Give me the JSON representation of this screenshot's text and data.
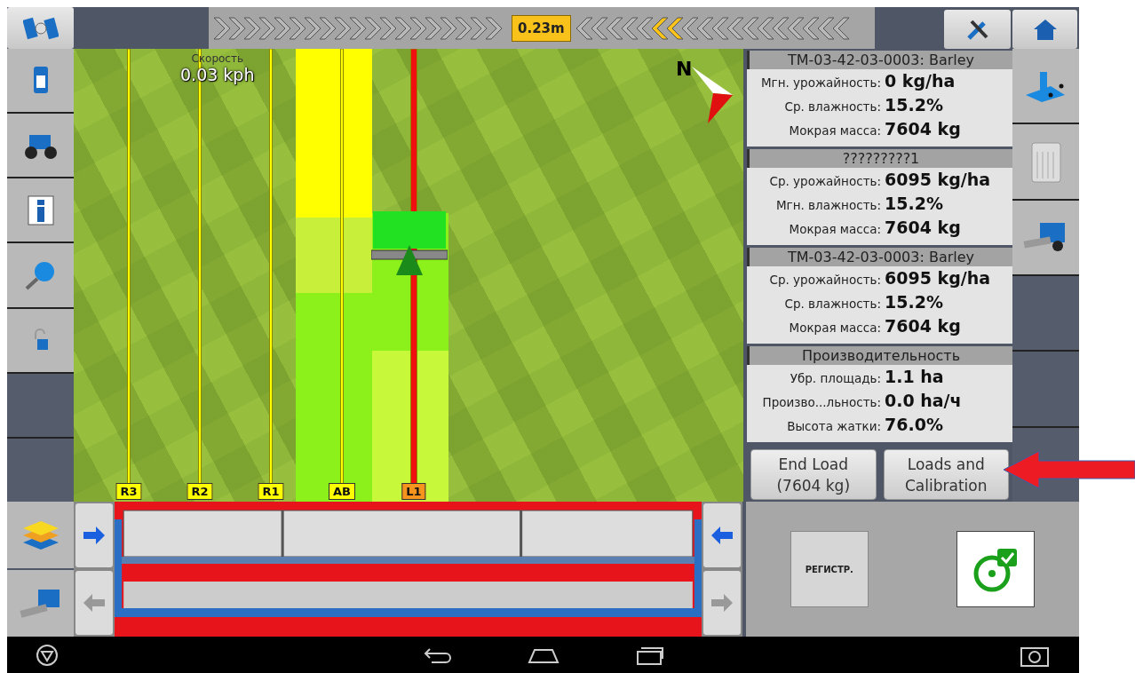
{
  "lightbar": {
    "offset": "0.23m"
  },
  "map": {
    "speed_label": "Скорость",
    "speed_value": "0.03 kph",
    "compass": "N",
    "guidance_lines": [
      {
        "label": "R3",
        "color": "#ffff00",
        "selected": false
      },
      {
        "label": "R2",
        "color": "#ffff00",
        "selected": false
      },
      {
        "label": "R1",
        "color": "#ffff00",
        "selected": false
      },
      {
        "label": "AB",
        "color": "#ffff00",
        "selected": false
      },
      {
        "label": "L1",
        "color": "#f7941d",
        "selected": true
      }
    ]
  },
  "info_panels": [
    {
      "title": "TM-03-42-03-0003: Barley",
      "rows": [
        {
          "label": "Мгн. урожайность:",
          "value": "0 kg/ha"
        },
        {
          "label": "Ср. влажность:",
          "value": "15.2%"
        },
        {
          "label": "Мокрая масса:",
          "value": "7604 kg"
        }
      ]
    },
    {
      "title": "?????????1",
      "rows": [
        {
          "label": "Ср. урожайность:",
          "value": "6095 kg/ha"
        },
        {
          "label": "Мгн. влажность:",
          "value": "15.2%"
        },
        {
          "label": "Мокрая масса:",
          "value": "7604 kg"
        }
      ]
    },
    {
      "title": "TM-03-42-03-0003: Barley",
      "rows": [
        {
          "label": "Ср. урожайность:",
          "value": "6095 kg/ha"
        },
        {
          "label": "Ср. влажность:",
          "value": "15.2%"
        },
        {
          "label": "Мокрая масса:",
          "value": "7604 kg"
        }
      ]
    },
    {
      "title": "Производительность",
      "rows": [
        {
          "label": "Убр. площадь:",
          "value": "1.1 ha"
        },
        {
          "label": "Произво...льность:",
          "value": "0.0 ha/ч"
        },
        {
          "label": "Высота жатки:",
          "value": "76.0%"
        }
      ]
    }
  ],
  "panel_buttons": [
    {
      "lines": [
        "End Load",
        "(7604 kg)"
      ]
    },
    {
      "lines": [
        "Loads and",
        "Calibration"
      ]
    }
  ],
  "register_button": "РЕГИСТР."
}
